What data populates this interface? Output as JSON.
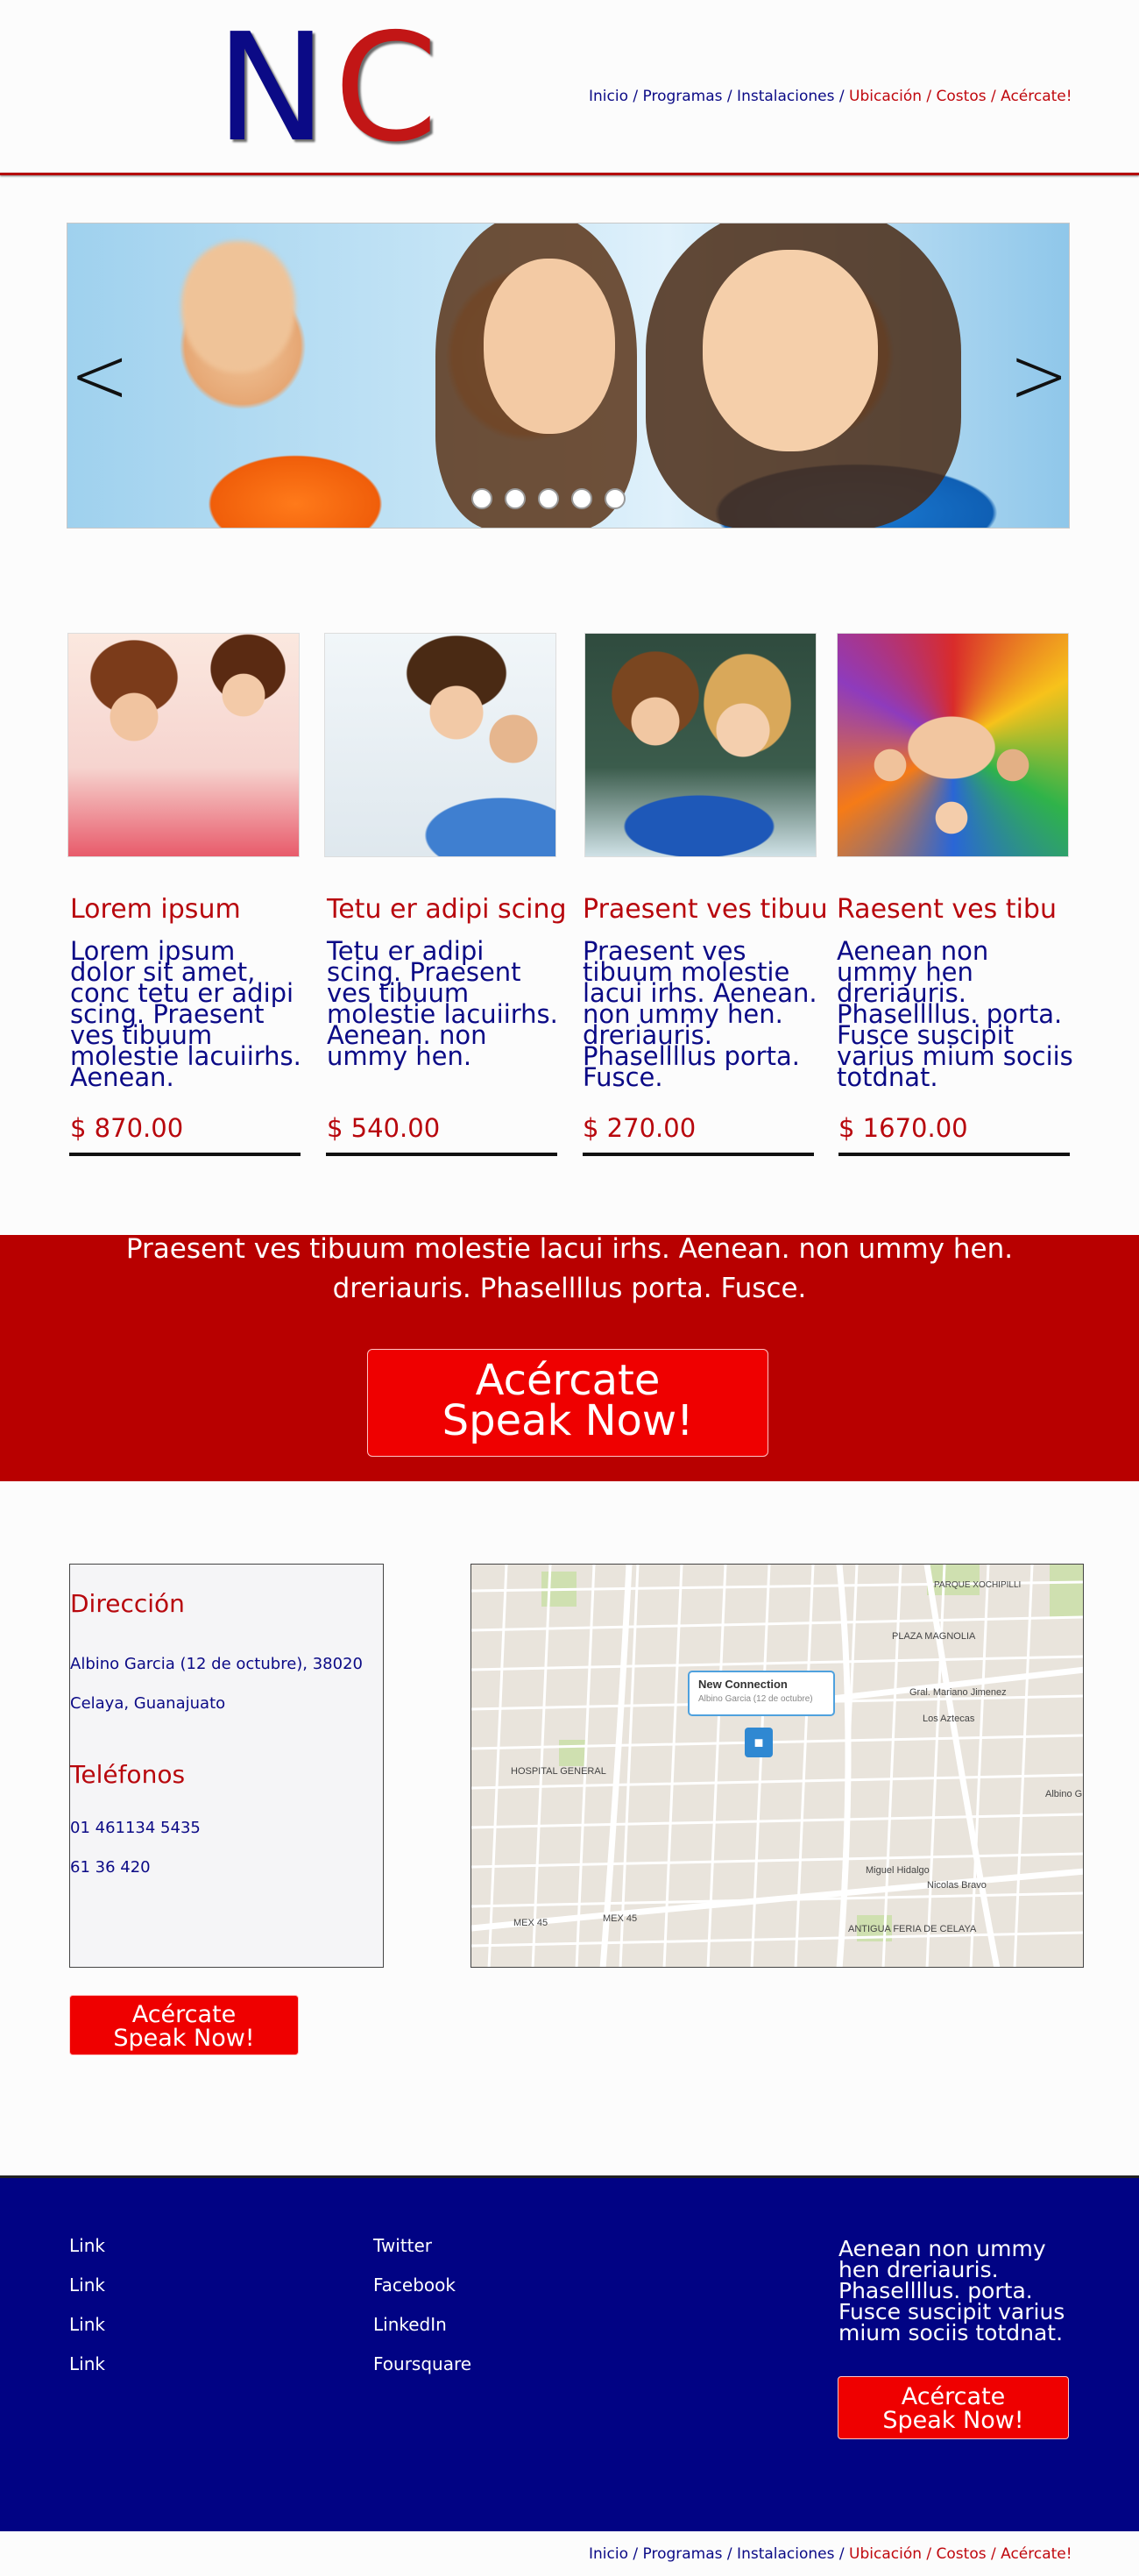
{
  "header": {
    "logo_n": "N",
    "logo_c": "C",
    "nav_blue": "Inicio / Programas / Instalaciones",
    "nav_red": "Ubicación / Costos / Acércate!"
  },
  "hero": {
    "prev_arrow": "<",
    "next_arrow": ">",
    "dot_count": 5
  },
  "cards": [
    {
      "title": "Lorem ipsum",
      "lines": [
        "Lorem ipsum",
        "dolor sit amet,",
        "conc tetu er adipi",
        "scing. Praesent",
        "ves tibuum",
        "molestie lacuiirhs.",
        "Aenean."
      ],
      "price": "$ 870.00"
    },
    {
      "title": "Tetu er adipi scing",
      "lines": [
        "Tetu er adipi",
        "scing. Praesent",
        "ves tibuum",
        "molestie lacuiirhs.",
        "Aenean. non",
        "ummy hen."
      ],
      "price": "$ 540.00"
    },
    {
      "title": "Praesent ves tibuu",
      "lines": [
        "Praesent ves",
        "tibuum molestie",
        "lacui irhs. Aenean.",
        "non ummy hen.",
        "dreriauris.",
        "Phasellllus porta.",
        "Fusce."
      ],
      "price": "$ 270.00"
    },
    {
      "title": "Raesent ves tibu",
      "lines": [
        "Aenean non",
        "ummy hen",
        "dreriauris.",
        "Phasellllus. porta.",
        "Fusce suscipit",
        "varius mium sociis",
        "totdnat."
      ],
      "price": "$ 1670.00"
    }
  ],
  "banner": {
    "line1": "Praesent ves tibuum molestie lacui irhs. Aenean. non ummy hen.",
    "line2": "dreriauris. Phasellllus porta. Fusce.",
    "cta_line1": "Acércate",
    "cta_line2": "Speak Now!"
  },
  "contact": {
    "address_heading": "Dirección",
    "address_line1": "Albino Garcia (12 de octubre), 38020",
    "address_line2": "Celaya, Guanajuato",
    "phones_heading": "Teléfonos",
    "phone1": "01 461134 5435",
    "phone2": "61 36 420",
    "cta_line1": "Acércate",
    "cta_line2": "Speak Now!"
  },
  "map": {
    "popup_title": "New Connection",
    "popup_sub": "Albino Garcia (12 de octubre)",
    "labels": [
      "PARQUE XOCHIPILLI",
      "PLAZA MAGNOLIA",
      "Gral. Mariano Jimenez",
      "Los Aztecas",
      "HOSPITAL GENERAL",
      "Miguel Hidalgo",
      "Nicolas Bravo",
      "MEX 45",
      "MEX 45",
      "ANTIGUA FERIA DE CELAYA",
      "Albino G"
    ]
  },
  "footer": {
    "col1": [
      "Link",
      "Link",
      "Link",
      "Link"
    ],
    "col2": [
      "Twitter",
      "Facebook",
      "LinkedIn",
      "Foursquare"
    ],
    "text_lines": [
      "Aenean non ummy",
      "hen dreriauris.",
      "Phasellllus. porta.",
      "Fusce suscipit varius",
      "mium sociis totdnat."
    ],
    "cta_line1": "Acércate",
    "cta_line2": "Speak Now!"
  },
  "bottom_nav": {
    "nav_blue": "Inicio / Programas / Instalaciones",
    "nav_red": "Ubicación / Costos / Acércate!"
  },
  "colors": {
    "navy": "#0b0a86",
    "red": "#b8070d",
    "banner_red": "#b80000",
    "button_red": "#ef0000",
    "footer_navy": "#010384"
  }
}
